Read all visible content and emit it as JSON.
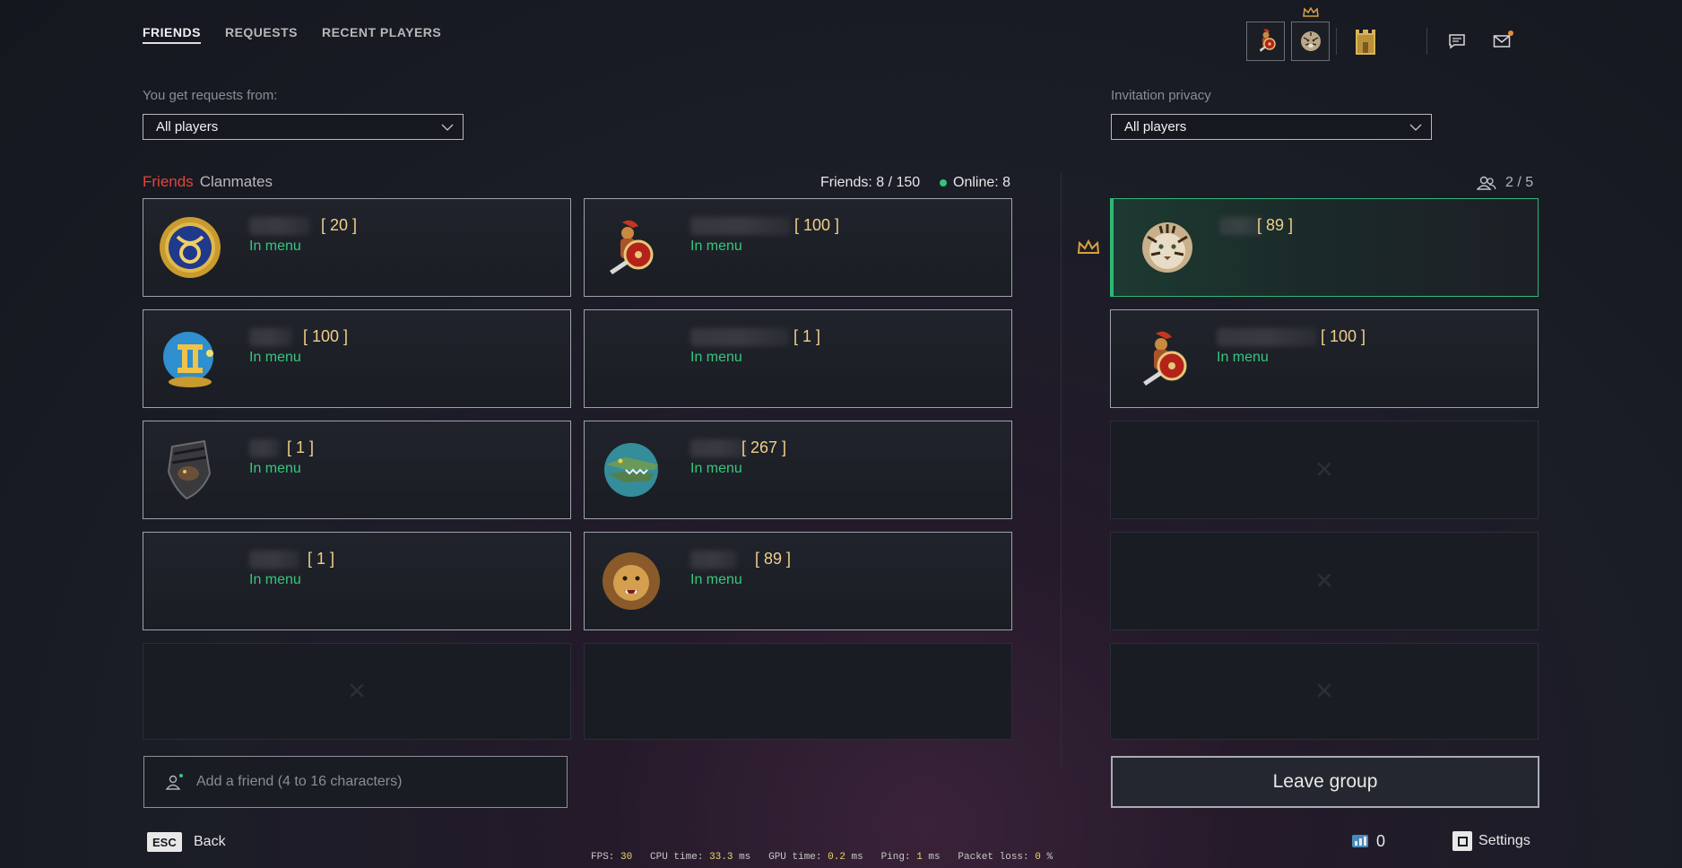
{
  "tabs": [
    {
      "label": "FRIENDS",
      "active": true
    },
    {
      "label": "REQUESTS",
      "active": false
    },
    {
      "label": "RECENT PLAYERS",
      "active": false
    }
  ],
  "requests_from": {
    "label": "You get requests from:",
    "value": "All players"
  },
  "invitation_privacy": {
    "label": "Invitation privacy",
    "value": "All players"
  },
  "friends_section": {
    "tab_friends": "Friends",
    "tab_clanmates": "Clanmates",
    "friends_count": "Friends: 8 / 150",
    "online_count": "Online: 8"
  },
  "friends": [
    {
      "level": "[ 20 ]",
      "status": "In menu",
      "avatar": "taurus-emblem-icon"
    },
    {
      "level": "[ 100 ]",
      "status": "In menu",
      "avatar": "spartan-warrior-icon"
    },
    {
      "level": "[ 100 ]",
      "status": "In menu",
      "avatar": "gemini-emblem-icon"
    },
    {
      "level": "[ 1 ]",
      "status": "In menu",
      "avatar": ""
    },
    {
      "level": "[ 1 ]",
      "status": "In menu",
      "avatar": "armored-shield-icon"
    },
    {
      "level": "[ 267 ]",
      "status": "In menu",
      "avatar": "crocodile-icon"
    },
    {
      "level": "[ 1 ]",
      "status": "In menu",
      "avatar": ""
    },
    {
      "level": "[ 89 ]",
      "status": "In menu",
      "avatar": "lion-icon"
    }
  ],
  "group": {
    "count": "2 / 5",
    "members": [
      {
        "level": "[ 89 ]",
        "status": "",
        "avatar": "tiger-icon",
        "leader": true
      },
      {
        "level": "[ 100 ]",
        "status": "In menu",
        "avatar": "spartan-warrior-icon",
        "leader": false
      }
    ],
    "empty_slots": 3,
    "leave_label": "Leave group"
  },
  "add_friend": {
    "placeholder": "Add a friend (4 to 16 characters)"
  },
  "bottom": {
    "esc_key": "ESC",
    "back_label": "Back",
    "currency_value": "0",
    "settings_label": "Settings"
  },
  "perf": {
    "fps_label": "FPS:",
    "fps": "30",
    "cpu_label": "CPU time:",
    "cpu": "33.3",
    "cpu_unit": "ms",
    "gpu_label": "GPU time:",
    "gpu": "0.2",
    "gpu_unit": "ms",
    "ping_label": "Ping:",
    "ping": "1",
    "ping_unit": "ms",
    "loss_label": "Packet loss:",
    "loss": "0",
    "loss_unit": "%"
  },
  "colors": {
    "accent_red": "#e0463c",
    "online_green": "#36c77c",
    "level_gold": "#f0cf8a",
    "leader_green": "#2fb874"
  }
}
